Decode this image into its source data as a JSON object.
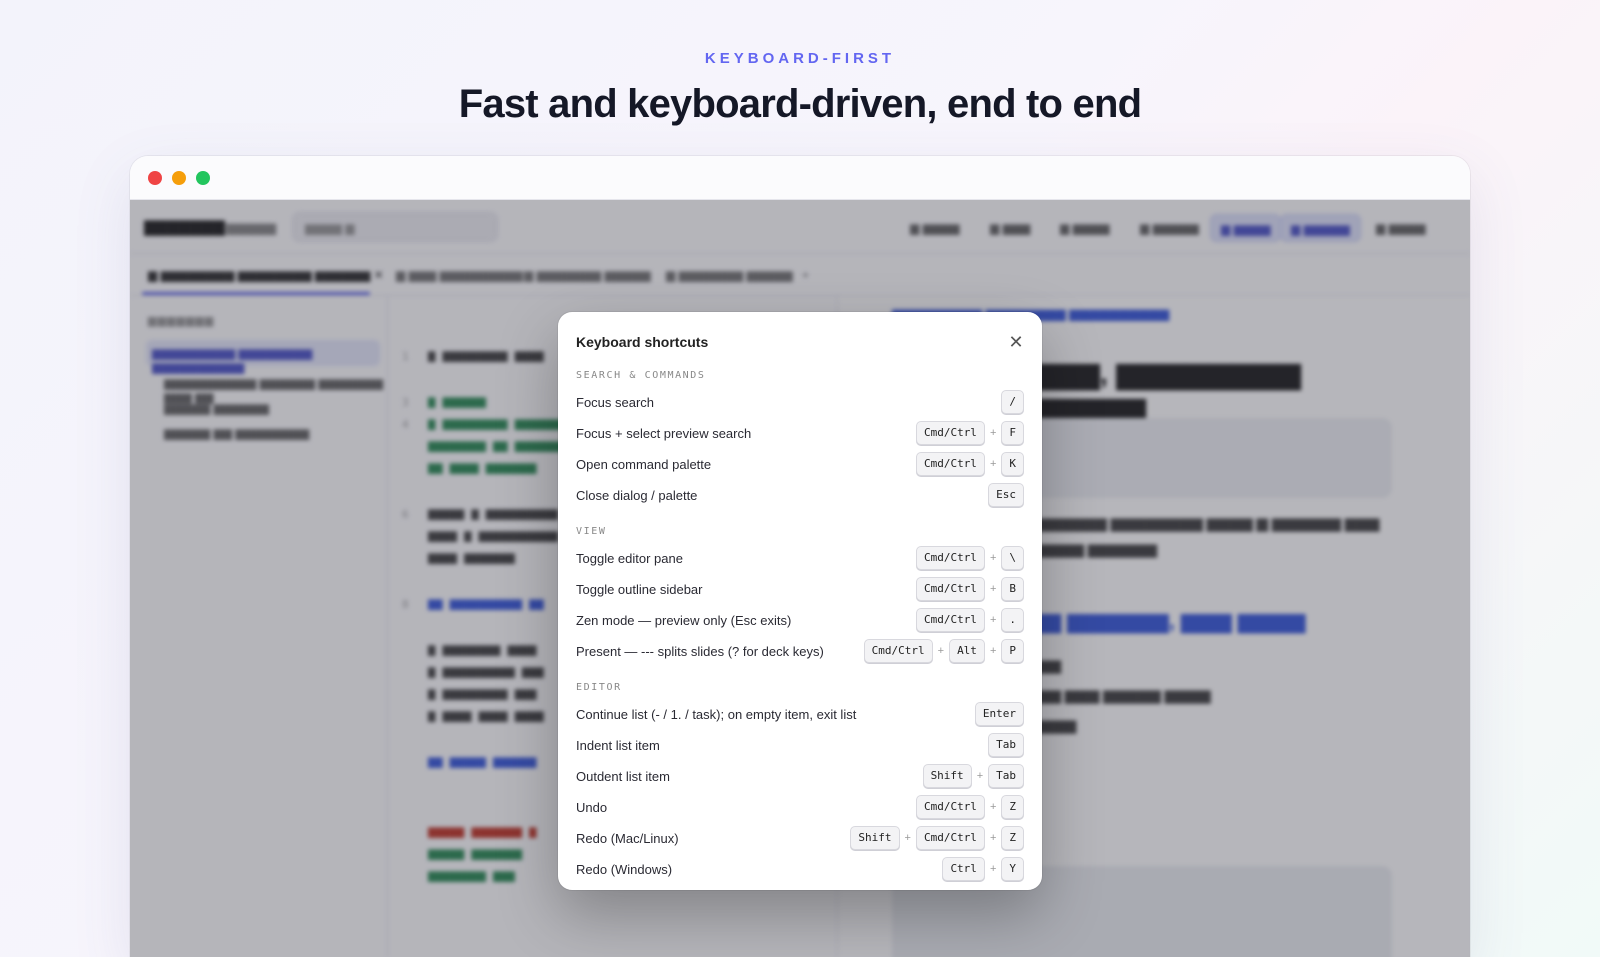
{
  "hero": {
    "eyebrow": "KEYBOARD-FIRST",
    "headline": "Fast and keyboard-driven, end to end"
  },
  "dialog": {
    "title": "Keyboard shortcuts",
    "close_icon": "close-icon",
    "sections": [
      {
        "title": "SEARCH & COMMANDS",
        "items": [
          {
            "label": "Focus search",
            "keys": [
              "/"
            ]
          },
          {
            "label": "Focus + select preview search",
            "keys": [
              "Cmd/Ctrl",
              "F"
            ]
          },
          {
            "label": "Open command palette",
            "keys": [
              "Cmd/Ctrl",
              "K"
            ]
          },
          {
            "label": "Close dialog / palette",
            "keys": [
              "Esc"
            ]
          }
        ]
      },
      {
        "title": "VIEW",
        "items": [
          {
            "label": "Toggle editor pane",
            "keys": [
              "Cmd/Ctrl",
              "\\"
            ]
          },
          {
            "label": "Toggle outline sidebar",
            "keys": [
              "Cmd/Ctrl",
              "B"
            ]
          },
          {
            "label": "Zen mode — preview only (Esc exits)",
            "keys": [
              "Cmd/Ctrl",
              "."
            ]
          },
          {
            "label": "Present — --- splits slides (? for deck keys)",
            "keys": [
              "Cmd/Ctrl",
              "Alt",
              "P"
            ]
          }
        ]
      },
      {
        "title": "EDITOR",
        "items": [
          {
            "label": "Continue list (- / 1. / task); on empty item, exit list",
            "keys": [
              "Enter"
            ]
          },
          {
            "label": "Indent list item",
            "keys": [
              "Tab"
            ]
          },
          {
            "label": "Outdent list item",
            "keys": [
              "Shift",
              "Tab"
            ]
          },
          {
            "label": "Undo",
            "keys": [
              "Cmd/Ctrl",
              "Z"
            ]
          },
          {
            "label": "Redo (Mac/Linux)",
            "keys": [
              "Shift",
              "Cmd/Ctrl",
              "Z"
            ]
          },
          {
            "label": "Redo (Windows)",
            "keys": [
              "Ctrl",
              "Y"
            ]
          }
        ]
      }
    ]
  }
}
